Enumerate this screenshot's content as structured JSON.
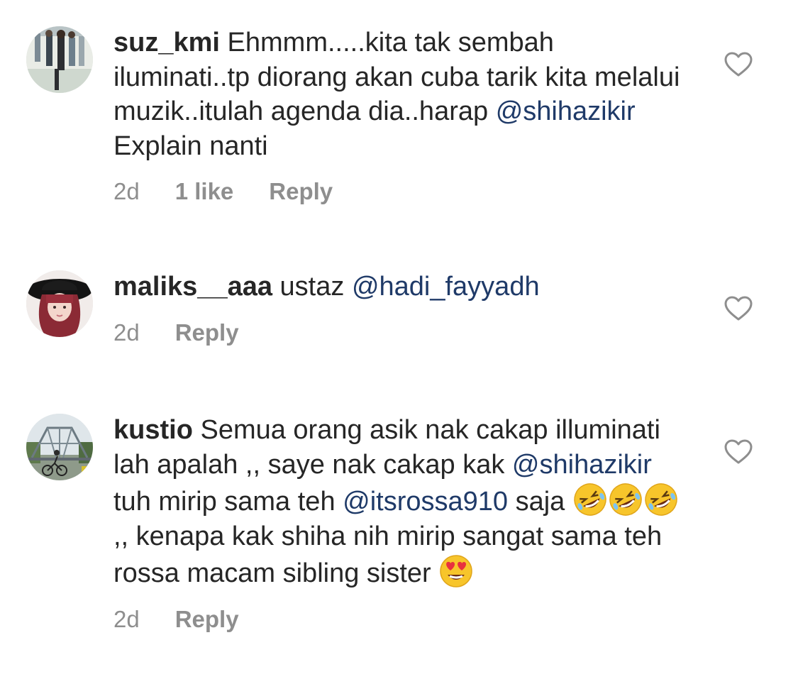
{
  "comments": [
    {
      "username": "suz_kmi",
      "text_parts": [
        {
          "t": "Ehmmm.....kita tak sembah iluminati..tp diorang akan cuba tarik kita melalui muzik..itulah agenda dia..harap "
        },
        {
          "m": "@shihazikir"
        },
        {
          "t": " Explain nanti"
        }
      ],
      "time": "2d",
      "likes": "1 like",
      "reply": "Reply",
      "avatar_icon": "user-avatar-group-photo",
      "like_icon": "heart-outline-icon"
    },
    {
      "username": "maliks__aaa",
      "text_parts": [
        {
          "t": "ustaz "
        },
        {
          "m": "@hadi_fayyadh"
        }
      ],
      "time": "2d",
      "likes": "",
      "reply": "Reply",
      "avatar_icon": "user-avatar-hat-portrait",
      "like_icon": "heart-outline-icon"
    },
    {
      "username": "kustio",
      "text_parts": [
        {
          "t": "Semua orang asik nak cakap illuminati lah apalah ,, saye nak cakap kak "
        },
        {
          "m": "@shihazikir"
        },
        {
          "t": " tuh mirip sama teh "
        },
        {
          "m": "@itsrossa910"
        },
        {
          "t": " saja "
        },
        {
          "e": "rofl"
        },
        {
          "e": "rofl"
        },
        {
          "e": "rofl"
        },
        {
          "t": " ,, kenapa kak shiha nih mirip sangat sama teh rossa macam sibling sister "
        },
        {
          "e": "heart-eyes"
        }
      ],
      "time": "2d",
      "likes": "",
      "reply": "Reply",
      "avatar_icon": "user-avatar-bridge-bicycle",
      "like_icon": "heart-outline-icon"
    }
  ],
  "colors": {
    "text": "#262626",
    "mention": "#1f3a68",
    "meta": "#8e8e8e",
    "heart_stroke": "#8e8e8e"
  }
}
